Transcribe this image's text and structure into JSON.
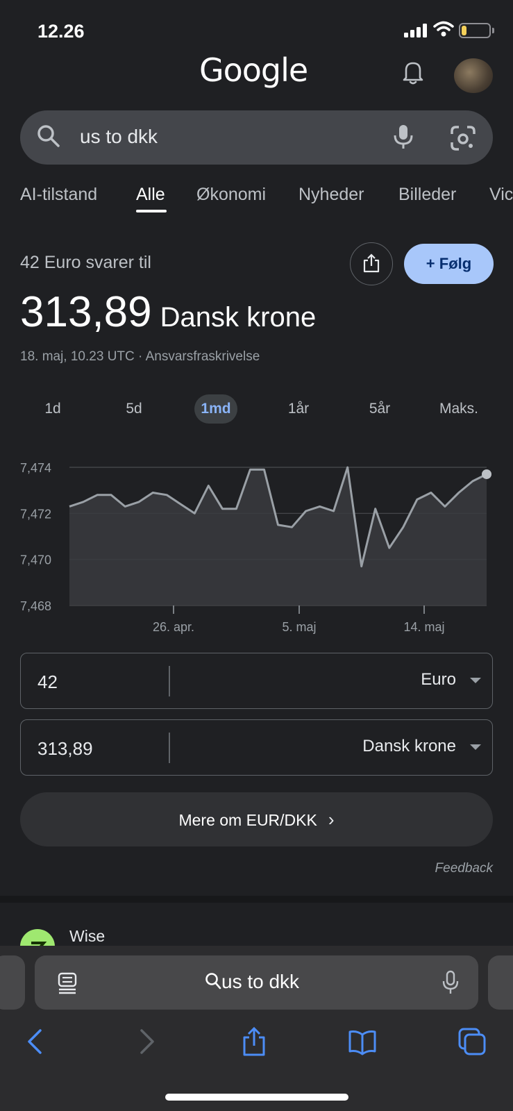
{
  "status_bar": {
    "time": "12.26",
    "battery": "7",
    "battery_level": 0.07
  },
  "header": {
    "logo": "Google"
  },
  "search": {
    "query": "us to dkk"
  },
  "tabs": [
    {
      "label": "AI-tilstand"
    },
    {
      "label": "Alle",
      "active": true
    },
    {
      "label": "Økonomi"
    },
    {
      "label": "Nyheder"
    },
    {
      "label": "Billeder"
    },
    {
      "label": "Vic"
    }
  ],
  "conversion": {
    "label": "42 Euro svarer til",
    "amount": "313,89",
    "currency": "Dansk krone",
    "meta": "18. maj, 10.23 UTC · Ansvarsfraskrivelse",
    "follow_label": "+ Følg"
  },
  "ranges": [
    {
      "label": "1d"
    },
    {
      "label": "5d"
    },
    {
      "label": "1md",
      "active": true
    },
    {
      "label": "1år"
    },
    {
      "label": "5år"
    },
    {
      "label": "Maks."
    }
  ],
  "chart_data": {
    "type": "area",
    "title": "",
    "xlabel": "",
    "ylabel": "",
    "ylim": [
      7.468,
      7.474
    ],
    "yticks": [
      "7,474",
      "7,472",
      "7,470",
      "7,468"
    ],
    "xticks": [
      "26. apr.",
      "5. maj",
      "14. maj"
    ],
    "grid": true,
    "series": [
      {
        "values": [
          7.4723,
          7.4725,
          7.4728,
          7.4728,
          7.4723,
          7.4725,
          7.4729,
          7.4728,
          7.4724,
          7.472,
          7.4732,
          7.4722,
          7.4722,
          7.4739,
          7.4739,
          7.4715,
          7.4714,
          7.4721,
          7.4723,
          7.4721,
          7.474,
          7.4697,
          7.4722,
          7.4705,
          7.4714,
          7.4726,
          7.4729,
          7.4723,
          7.4729,
          7.4734,
          7.4737
        ]
      }
    ],
    "colors": {
      "line": "#9aa0a6",
      "fill": "#3a3b3e",
      "grid": "#4a4c50"
    }
  },
  "converter": {
    "from": {
      "value": "42",
      "currency": "Euro"
    },
    "to": {
      "value": "313,89",
      "currency": "Dansk krone"
    }
  },
  "more_button": {
    "label": "Mere om EUR/DKK",
    "chevron": "›"
  },
  "feedback": "Feedback",
  "result": {
    "name": "Wise"
  },
  "safari": {
    "address": "us to dkk"
  },
  "icons": [
    "signal-icon",
    "wifi-icon",
    "battery-icon",
    "bell-icon",
    "avatar",
    "search-icon",
    "mic-icon",
    "lens-icon",
    "share-icon",
    "reader-icon",
    "back-icon",
    "forward-icon",
    "bookmarks-icon",
    "tabs-icon"
  ]
}
